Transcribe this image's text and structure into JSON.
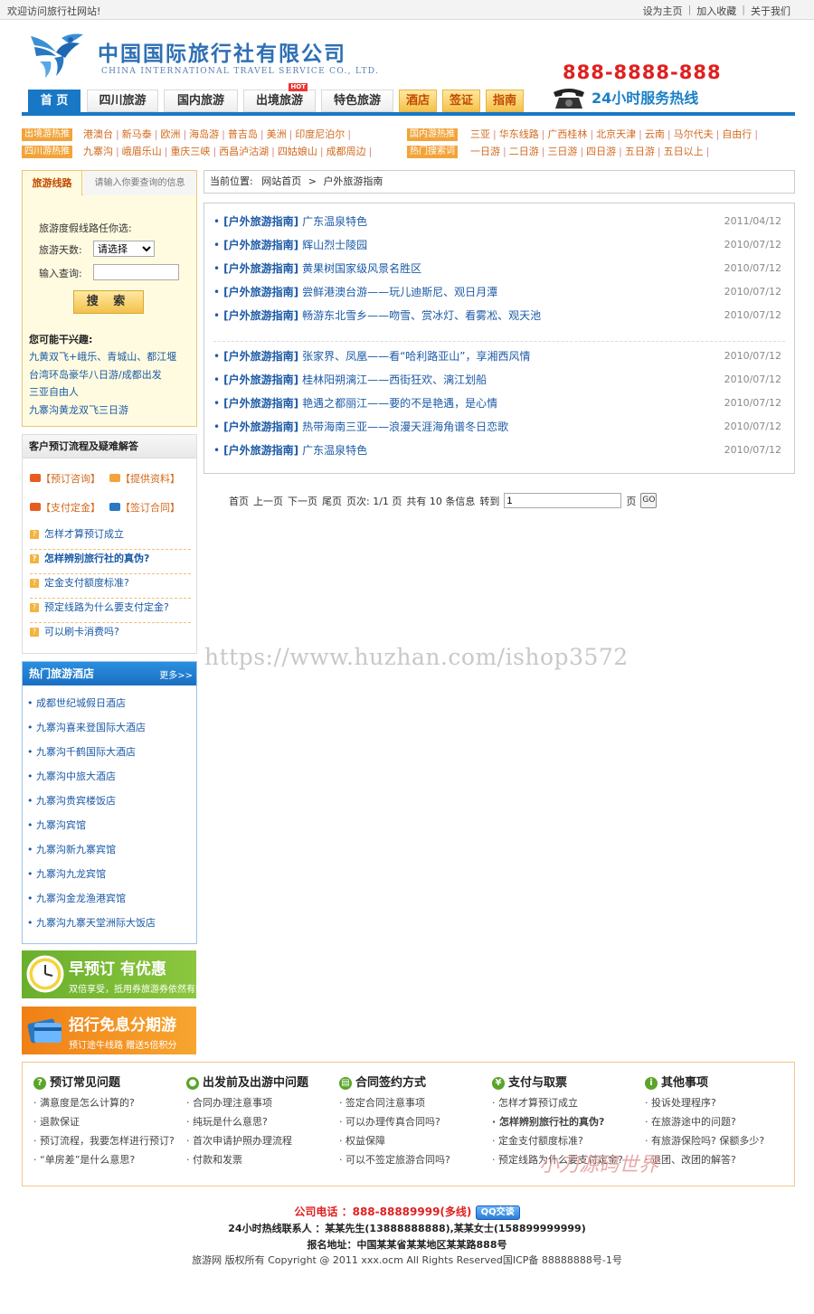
{
  "topbar": {
    "welcome": "欢迎访问旅行社网站!",
    "links": [
      "设为主页",
      "加入收藏",
      "关于我们"
    ]
  },
  "logo": {
    "cn": "中国国际旅行社有限公司",
    "en": "CHINA INTERNATIONAL TRAVEL SERVICE CO., LTD."
  },
  "hotline": {
    "number": "888-8888-888",
    "text": "24小时服务热线"
  },
  "nav": {
    "items": [
      "首 页",
      "四川旅游",
      "国内旅游",
      "出境旅游",
      "特色旅游",
      "酒店",
      "签证",
      "指南"
    ],
    "hot_badge": "HOT"
  },
  "hot_rows": {
    "row1": {
      "tag1": "出境游热推",
      "items1": [
        "港澳台",
        "新马泰",
        "欧洲",
        "海岛游",
        "普吉岛",
        "美洲",
        "印度尼泊尔"
      ],
      "tag2": "国内游热推",
      "items2": [
        "三亚",
        "华东线路",
        "广西桂林",
        "北京天津",
        "云南",
        "马尔代夫",
        "自由行"
      ]
    },
    "row2": {
      "tag1": "四川游热推",
      "items1": [
        "九寨沟",
        "峨眉乐山",
        "重庆三峡",
        "西昌泸沽湖",
        "四姑娘山",
        "成都周边"
      ],
      "tag2": "热门搜索词",
      "items2": [
        "一日游",
        "二日游",
        "三日游",
        "四日游",
        "五日游",
        "五日以上"
      ]
    }
  },
  "search": {
    "tab_active": "旅游线路",
    "tab_other": "请输入你要查询的信息",
    "label_title": "旅游度假线路任你选:",
    "label_days": "旅游天数:",
    "days_selected": "请选择",
    "label_query": "输入查询:",
    "button": "搜 索",
    "interest_title": "您可能干兴趣:",
    "interest_items": [
      "九黄双飞+峨乐、青城山、都江堰",
      "台湾环岛豪华八日游/成都出发",
      "三亚自由人",
      "九寨沟黄龙双飞三日游"
    ]
  },
  "process": {
    "title": "客户预订流程及疑难解答",
    "links": [
      "【预订咨询】",
      "【提供资料】",
      "【支付定金】",
      "【签订合同】"
    ],
    "faqs": [
      "怎样才算预订成立",
      "怎样辨别旅行社的真伪?",
      "定金支付额度标准?",
      "预定线路为什么要支付定金?",
      "可以刷卡消费吗?"
    ]
  },
  "hotels": {
    "title": "热门旅游酒店",
    "more": "更多>>",
    "items": [
      "成都世纪城假日酒店",
      "九寨沟喜来登国际大酒店",
      "九寨沟千鹤国际大酒店",
      "九寨沟中旅大酒店",
      "九寨沟贵宾楼饭店",
      "九寨沟宾馆",
      "九寨沟新九寨宾馆",
      "九寨沟九龙宾馆",
      "九寨沟金龙渔港宾馆",
      "九寨沟九寨天堂洲际大饭店"
    ]
  },
  "banners": {
    "b1_big": "早预订 有优惠",
    "b1_small": "双倍享受，抵用券旅游券依然有效",
    "b2_big": "招行免息分期游",
    "b2_small": "预订途牛线路  赠送5倍积分"
  },
  "breadcrumb": {
    "label": "当前位置:",
    "home": "网站首页",
    "sep": ">",
    "current": "户外旅游指南"
  },
  "articles": [
    {
      "cat": "[户外旅游指南]",
      "title": "广东温泉特色",
      "date": "2011/04/12"
    },
    {
      "cat": "[户外旅游指南]",
      "title": "辉山烈士陵园",
      "date": "2010/07/12"
    },
    {
      "cat": "[户外旅游指南]",
      "title": "黄果树国家级风景名胜区",
      "date": "2010/07/12"
    },
    {
      "cat": "[户外旅游指南]",
      "title": "尝鲜港澳台游——玩儿迪斯尼、观日月潭",
      "date": "2010/07/12"
    },
    {
      "cat": "[户外旅游指南]",
      "title": "畅游东北雪乡——吻雪、赏冰灯、看雾凇、观天池",
      "date": "2010/07/12"
    },
    {
      "cat": "[户外旅游指南]",
      "title": "张家界、凤凰——看“哈利路亚山”，享湘西风情",
      "date": "2010/07/12"
    },
    {
      "cat": "[户外旅游指南]",
      "title": "桂林阳朔漓江——西街狂欢、漓江划船",
      "date": "2010/07/12"
    },
    {
      "cat": "[户外旅游指南]",
      "title": "艳遇之都丽江——要的不是艳遇，是心情",
      "date": "2010/07/12"
    },
    {
      "cat": "[户外旅游指南]",
      "title": "热带海南三亚——浪漫天涯海角谱冬日恋歌",
      "date": "2010/07/12"
    },
    {
      "cat": "[户外旅游指南]",
      "title": "广东温泉特色",
      "date": "2010/07/12"
    }
  ],
  "pager": {
    "first": "首页",
    "prev": "上一页",
    "next": "下一页",
    "last": "尾页",
    "pages": "页次: 1/1 页",
    "total": "共有 10 条信息",
    "goto": "转到",
    "input_value": "1",
    "unit": "页",
    "go": "GO"
  },
  "watermark": "https://www.huzhan.com/ishop3572",
  "watermark2": "小刀源码世界",
  "help": [
    {
      "title": "预订常见问题",
      "items": [
        "满意度是怎么计算的?",
        "退款保证",
        "预订流程，我要怎样进行预订?",
        "“单房差”是什么意思?"
      ]
    },
    {
      "title": "出发前及出游中问题",
      "items": [
        "合同办理注意事项",
        "纯玩是什么意思?",
        "首次申请护照办理流程",
        "付款和发票"
      ]
    },
    {
      "title": "合同签约方式",
      "items": [
        "签定合同注意事项",
        "可以办理传真合同吗?",
        "权益保障",
        "可以不签定旅游合同吗?"
      ]
    },
    {
      "title": "支付与取票",
      "items": [
        "怎样才算预订成立",
        "怎样辨别旅行社的真伪?",
        "定金支付额度标准?",
        "预定线路为什么要支付定金?"
      ]
    },
    {
      "title": "其他事项",
      "items": [
        "投诉处理程序?",
        "在旅游途中的问题?",
        "有旅游保险吗? 保额多少?",
        "退团、改团的解答?"
      ]
    }
  ],
  "footer": {
    "phone_label": "公司电话",
    "phone": "：888-88889999(多线)",
    "qq": "QQ交谈",
    "contact": "24小时热线联系人 ：某某先生(13888888888),某某女士(158899999999)",
    "address": "报名地址：中国某某省某某地区某某路888号",
    "copyright": "旅游网 版权所有 Copyright @ 2011 xxx.ocm All Rights Reserved国ICP备 88888888号-1号"
  }
}
